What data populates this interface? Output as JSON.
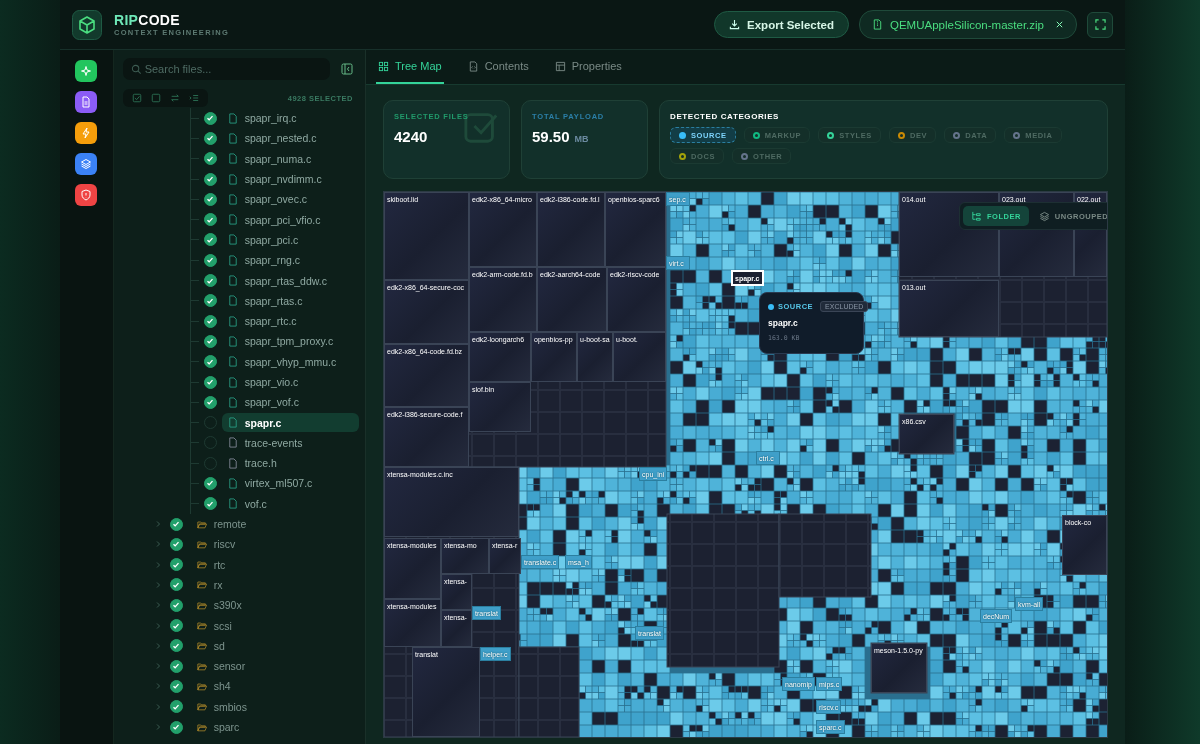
{
  "header": {
    "brand_prefix": "RIP",
    "brand_suffix": "CODE",
    "tagline": "CONTEXT ENGINEERING",
    "export_button": "Export Selected",
    "file_chip": "QEMUAppleSilicon-master.zip"
  },
  "rail": [
    {
      "kind": "sparkle",
      "color": "#22c55e"
    },
    {
      "kind": "document",
      "color": "#8b5cf6"
    },
    {
      "kind": "lightning",
      "color": "#f59e0b"
    },
    {
      "kind": "layers",
      "color": "#3b82f6"
    },
    {
      "kind": "shield",
      "color": "#ef4444"
    }
  ],
  "sidebar": {
    "search": {
      "placeholder": "Search files..."
    },
    "selected_count": "4928 SELECTED",
    "tree": {
      "children": [
        {
          "name": "spapr_irq.c",
          "kind": "source",
          "checked": true,
          "selected": false
        },
        {
          "name": "spapr_nested.c",
          "kind": "source",
          "checked": true,
          "selected": false
        },
        {
          "name": "spapr_numa.c",
          "kind": "source",
          "checked": true,
          "selected": false
        },
        {
          "name": "spapr_nvdimm.c",
          "kind": "source",
          "checked": true,
          "selected": false
        },
        {
          "name": "spapr_ovec.c",
          "kind": "source",
          "checked": true,
          "selected": false
        },
        {
          "name": "spapr_pci_vfio.c",
          "kind": "source",
          "checked": true,
          "selected": false
        },
        {
          "name": "spapr_pci.c",
          "kind": "source",
          "checked": true,
          "selected": false
        },
        {
          "name": "spapr_rng.c",
          "kind": "source",
          "checked": true,
          "selected": false
        },
        {
          "name": "spapr_rtas_ddw.c",
          "kind": "source",
          "checked": true,
          "selected": false
        },
        {
          "name": "spapr_rtas.c",
          "kind": "source",
          "checked": true,
          "selected": false
        },
        {
          "name": "spapr_rtc.c",
          "kind": "source",
          "checked": true,
          "selected": false
        },
        {
          "name": "spapr_tpm_proxy.c",
          "kind": "source",
          "checked": true,
          "selected": false
        },
        {
          "name": "spapr_vhyp_mmu.c",
          "kind": "source",
          "checked": true,
          "selected": false
        },
        {
          "name": "spapr_vio.c",
          "kind": "source",
          "checked": true,
          "selected": false
        },
        {
          "name": "spapr_vof.c",
          "kind": "source",
          "checked": true,
          "selected": false
        },
        {
          "name": "spapr.c",
          "kind": "source",
          "checked": false,
          "selected": true
        },
        {
          "name": "trace-events",
          "kind": "other",
          "checked": false,
          "selected": false
        },
        {
          "name": "trace.h",
          "kind": "other",
          "checked": false,
          "selected": false
        },
        {
          "name": "virtex_ml507.c",
          "kind": "source",
          "checked": true,
          "selected": false
        },
        {
          "name": "vof.c",
          "kind": "source",
          "checked": true,
          "selected": false
        }
      ],
      "folders": [
        {
          "name": "remote",
          "checked": true,
          "expanded": false
        },
        {
          "name": "riscv",
          "checked": true,
          "expanded": false
        },
        {
          "name": "rtc",
          "checked": true,
          "expanded": false
        },
        {
          "name": "rx",
          "checked": true,
          "expanded": false
        },
        {
          "name": "s390x",
          "checked": true,
          "expanded": false
        },
        {
          "name": "scsi",
          "checked": true,
          "expanded": false
        },
        {
          "name": "sd",
          "checked": true,
          "expanded": false
        },
        {
          "name": "sensor",
          "checked": true,
          "expanded": false
        },
        {
          "name": "sh4",
          "checked": true,
          "expanded": false
        },
        {
          "name": "smbios",
          "checked": true,
          "expanded": false
        },
        {
          "name": "sparc",
          "checked": true,
          "expanded": false
        }
      ]
    }
  },
  "tabs": [
    {
      "label": "Tree Map",
      "kind": "grid",
      "selected": true
    },
    {
      "label": "Contents",
      "kind": "file",
      "selected": false
    },
    {
      "label": "Properties",
      "kind": "table",
      "selected": false
    }
  ],
  "stats": {
    "selected_files": {
      "label": "SELECTED FILES",
      "value": "4240"
    },
    "total_payload": {
      "label": "TOTAL PAYLOAD",
      "value": "59.50",
      "unit": "MB"
    }
  },
  "categories": {
    "title": "DETECTED CATEGORIES",
    "items": [
      {
        "label": "SOURCE",
        "color": "#38bdf8",
        "selected": true
      },
      {
        "label": "MARKUP",
        "color": "#10b981",
        "selected": false
      },
      {
        "label": "STYLES",
        "color": "#34d399",
        "selected": false
      },
      {
        "label": "DEV",
        "color": "#ca8a04",
        "selected": false
      },
      {
        "label": "DATA",
        "color": "#64748b",
        "selected": false
      },
      {
        "label": "MEDIA",
        "color": "#64748b",
        "selected": false
      },
      {
        "label": "DOCS",
        "color": "#a3a30a",
        "selected": false
      },
      {
        "label": "OTHER",
        "color": "#64748b",
        "selected": false
      }
    ]
  },
  "treemap": {
    "grouping": [
      {
        "label": "FOLDER",
        "kind": "folder",
        "selected": true
      },
      {
        "label": "UNGROUPED",
        "kind": "layers",
        "selected": false
      }
    ],
    "tooltip": {
      "category": "SOURCE",
      "color": "#38bdf8",
      "status": "EXCLUDED",
      "name": "spapr.c",
      "size": "163.0 KB"
    },
    "tiles": [
      {
        "label": "skiboot.lid",
        "included": false,
        "selected": false
      },
      {
        "label": "edk2-x86_64-micro",
        "included": false,
        "selected": false
      },
      {
        "label": "edk2-i386-code.fd.l",
        "included": false,
        "selected": false
      },
      {
        "label": "openbios-sparc6",
        "included": false,
        "selected": false
      },
      {
        "label": "edk2-x86_64-secure-coc",
        "included": false,
        "selected": false
      },
      {
        "label": "edk2-arm-code.fd.b",
        "included": false,
        "selected": false
      },
      {
        "label": "edk2-aarch64-code",
        "included": false,
        "selected": false
      },
      {
        "label": "edk2-riscv-code",
        "included": false,
        "selected": false
      },
      {
        "label": "edk2-x86_64-code.fd.bz",
        "included": false,
        "selected": false
      },
      {
        "label": "edk2-loongarch6",
        "included": false,
        "selected": false
      },
      {
        "label": "openbios-pp",
        "included": false,
        "selected": false
      },
      {
        "label": "u-boot-sa",
        "included": false,
        "selected": false
      },
      {
        "label": "u-boot.",
        "included": false,
        "selected": false
      },
      {
        "label": "slof.bin",
        "included": false,
        "selected": false
      },
      {
        "label": "edk2-i386-secure-code.f",
        "included": false,
        "selected": false
      },
      {
        "label": "sep.c",
        "included": true,
        "selected": false
      },
      {
        "label": "virt.c",
        "included": true,
        "selected": false
      },
      {
        "label": "spapr.c",
        "included": false,
        "selected": true
      },
      {
        "label": "014.out",
        "included": false,
        "selected": false
      },
      {
        "label": "023.out",
        "included": false,
        "selected": false
      },
      {
        "label": "022.out",
        "included": false,
        "selected": false
      },
      {
        "label": "013.out",
        "included": false,
        "selected": false
      },
      {
        "label": "x86.csv",
        "included": false,
        "selected": false
      },
      {
        "label": "ctrl.c",
        "included": true,
        "selected": false
      },
      {
        "label": "xtensa-modules.c.inc",
        "included": false,
        "selected": false
      },
      {
        "label": "cpu_ini",
        "included": true,
        "selected": false
      },
      {
        "label": "xtensa-modules",
        "included": false,
        "selected": false
      },
      {
        "label": "xtensa-mo",
        "included": false,
        "selected": false
      },
      {
        "label": "xtensa-r",
        "included": false,
        "selected": false
      },
      {
        "label": "xtensa-",
        "included": false,
        "selected": false
      },
      {
        "label": "xtensa-modules",
        "included": false,
        "selected": false
      },
      {
        "label": "xtensa-",
        "included": false,
        "selected": false
      },
      {
        "label": "translat",
        "included": true,
        "selected": false
      },
      {
        "label": "translate.c",
        "included": true,
        "selected": false
      },
      {
        "label": "msa_h",
        "included": true,
        "selected": false
      },
      {
        "label": "translat",
        "included": true,
        "selected": false
      },
      {
        "label": "translat",
        "included": false,
        "selected": false
      },
      {
        "label": "helper.c",
        "included": true,
        "selected": false
      },
      {
        "label": "block-co",
        "included": false,
        "selected": false
      },
      {
        "label": "kvm-all",
        "included": true,
        "selected": false
      },
      {
        "label": "decNum",
        "included": true,
        "selected": false
      },
      {
        "label": "meson-1.5.0-py",
        "included": false,
        "selected": false
      },
      {
        "label": "nanomip",
        "included": true,
        "selected": false
      },
      {
        "label": "mips.c",
        "included": true,
        "selected": false
      },
      {
        "label": "riscv.c",
        "included": true,
        "selected": false
      },
      {
        "label": "sparc.c",
        "included": true,
        "selected": false
      }
    ]
  }
}
